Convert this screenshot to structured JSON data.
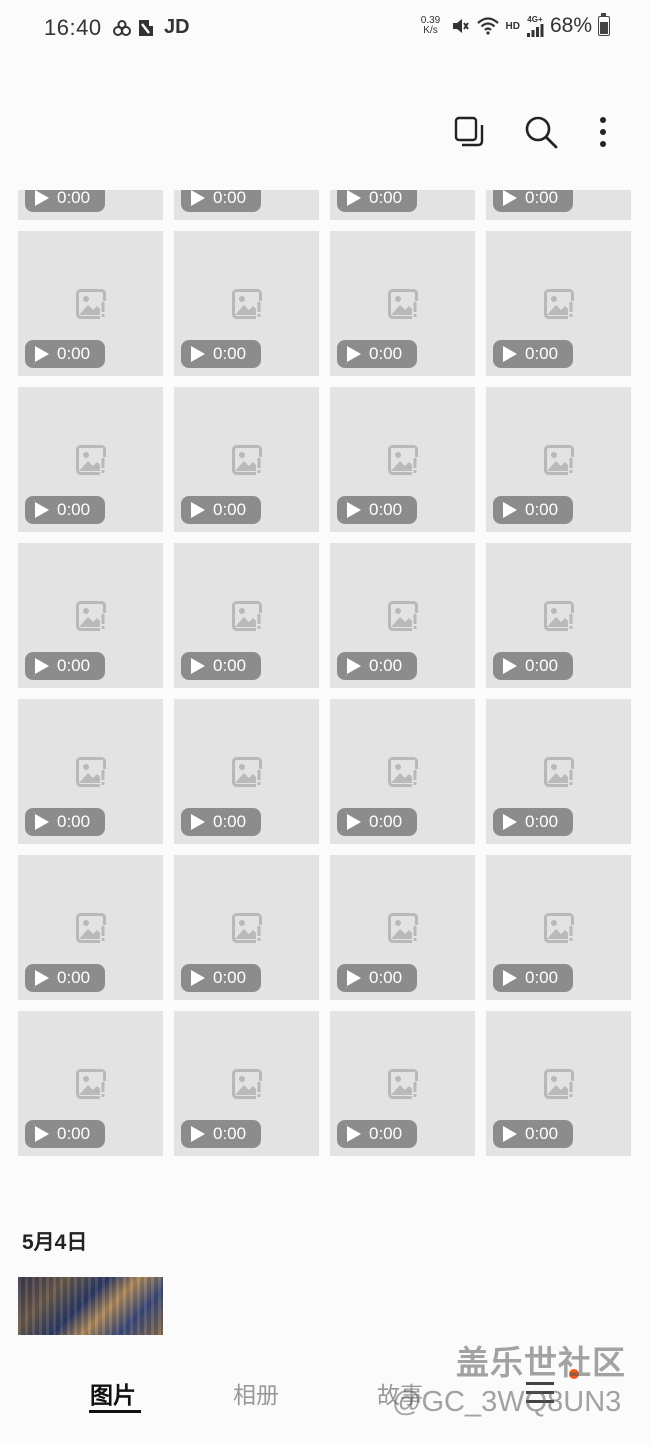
{
  "status_bar": {
    "time": "16:40",
    "carrier_label": "JD",
    "net_speed_value": "0.39",
    "net_speed_unit": "K/s",
    "hd_label": "HD",
    "network_label": "4G+",
    "battery_percent": "68%",
    "battery_level": 0.68
  },
  "toolbar": {
    "icons": [
      "select-icon",
      "search-icon",
      "more-options-icon"
    ]
  },
  "grid": {
    "columns": 4,
    "placeholder_icon": "image-unavailable-icon",
    "video_icon": "play-icon",
    "items": [
      {
        "duration": "0:00"
      },
      {
        "duration": "0:00"
      },
      {
        "duration": "0:00"
      },
      {
        "duration": "0:00"
      },
      {
        "duration": "0:00"
      },
      {
        "duration": "0:00"
      },
      {
        "duration": "0:00"
      },
      {
        "duration": "0:00"
      },
      {
        "duration": "0:00"
      },
      {
        "duration": "0:00"
      },
      {
        "duration": "0:00"
      },
      {
        "duration": "0:00"
      },
      {
        "duration": "0:00"
      },
      {
        "duration": "0:00"
      },
      {
        "duration": "0:00"
      },
      {
        "duration": "0:00"
      },
      {
        "duration": "0:00"
      },
      {
        "duration": "0:00"
      },
      {
        "duration": "0:00"
      },
      {
        "duration": "0:00"
      },
      {
        "duration": "0:00"
      },
      {
        "duration": "0:00"
      },
      {
        "duration": "0:00"
      },
      {
        "duration": "0:00"
      },
      {
        "duration": "0:00"
      },
      {
        "duration": "0:00"
      },
      {
        "duration": "0:00"
      },
      {
        "duration": "0:00"
      }
    ]
  },
  "section": {
    "date": "5月4日"
  },
  "bottom_nav": {
    "tabs": [
      {
        "label": "图片",
        "active": true
      },
      {
        "label": "相册",
        "active": false
      },
      {
        "label": "故事",
        "active": false
      }
    ],
    "menu_icon": "menu-icon",
    "accent_color": "#f05a1a"
  },
  "watermark": {
    "line1": "盖乐世社区",
    "line2": "@GC_3WQ8UN3"
  }
}
